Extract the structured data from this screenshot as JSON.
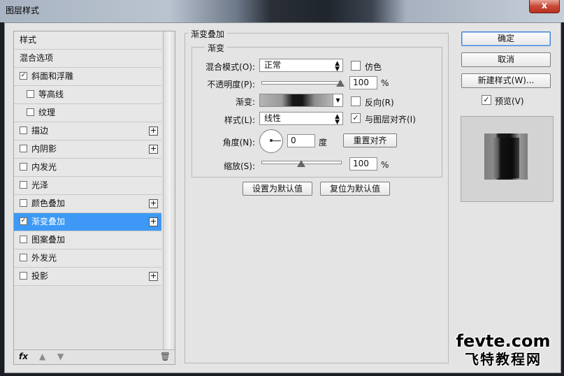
{
  "window": {
    "title": "图层样式",
    "close_label": "x"
  },
  "styles_list": {
    "items": [
      {
        "label": "样式",
        "checkbox": false,
        "checked": false,
        "plus": false,
        "sub": false,
        "selected": false
      },
      {
        "label": "混合选项",
        "checkbox": false,
        "checked": false,
        "plus": false,
        "sub": false,
        "selected": false
      },
      {
        "label": "斜面和浮雕",
        "checkbox": true,
        "checked": true,
        "plus": false,
        "sub": false,
        "selected": false
      },
      {
        "label": "等高线",
        "checkbox": true,
        "checked": false,
        "plus": false,
        "sub": true,
        "selected": false
      },
      {
        "label": "纹理",
        "checkbox": true,
        "checked": false,
        "plus": false,
        "sub": true,
        "selected": false
      },
      {
        "label": "描边",
        "checkbox": true,
        "checked": false,
        "plus": true,
        "sub": false,
        "selected": false
      },
      {
        "label": "内阴影",
        "checkbox": true,
        "checked": false,
        "plus": true,
        "sub": false,
        "selected": false
      },
      {
        "label": "内发光",
        "checkbox": true,
        "checked": false,
        "plus": false,
        "sub": false,
        "selected": false
      },
      {
        "label": "光泽",
        "checkbox": true,
        "checked": false,
        "plus": false,
        "sub": false,
        "selected": false
      },
      {
        "label": "颜色叠加",
        "checkbox": true,
        "checked": false,
        "plus": true,
        "sub": false,
        "selected": false
      },
      {
        "label": "渐变叠加",
        "checkbox": true,
        "checked": true,
        "plus": true,
        "sub": false,
        "selected": true
      },
      {
        "label": "图案叠加",
        "checkbox": true,
        "checked": false,
        "plus": false,
        "sub": false,
        "selected": false
      },
      {
        "label": "外发光",
        "checkbox": true,
        "checked": false,
        "plus": false,
        "sub": false,
        "selected": false
      },
      {
        "label": "投影",
        "checkbox": true,
        "checked": false,
        "plus": true,
        "sub": false,
        "selected": false
      }
    ],
    "bottom": {
      "fx_label": "fx",
      "up_icon": "arrow-up-icon",
      "down_icon": "arrow-down-icon",
      "trash_icon": "trash-icon"
    }
  },
  "gradient_overlay": {
    "section_title": "渐变叠加",
    "group_title": "渐变",
    "blend_mode_label": "混合模式(O):",
    "blend_mode_value": "正常",
    "dither_label": "仿色",
    "dither_checked": false,
    "opacity_label": "不透明度(P):",
    "opacity_value": "100",
    "opacity_unit": "%",
    "opacity_level": 1.0,
    "gradient_label": "渐变:",
    "reverse_label": "反向(R)",
    "reverse_checked": false,
    "style_label": "样式(L):",
    "style_value": "线性",
    "align_label": "与图层对齐(I)",
    "align_checked": true,
    "angle_label": "角度(N):",
    "angle_value": "0",
    "angle_unit": "度",
    "reset_align_label": "重置对齐",
    "scale_label": "缩放(S):",
    "scale_value": "100",
    "scale_unit": "%",
    "scale_level": 0.5,
    "make_default_label": "设置为默认值",
    "reset_default_label": "复位为默认值"
  },
  "actions": {
    "ok_label": "确定",
    "cancel_label": "取消",
    "new_style_label": "新建样式(W)...",
    "preview_label": "预览(V)",
    "preview_checked": true
  },
  "watermark": {
    "line1": "fevte.com",
    "line2": "飞特教程网"
  },
  "colors": {
    "selected": "#3d99f5",
    "default_button_border": "#3a7fd5"
  }
}
